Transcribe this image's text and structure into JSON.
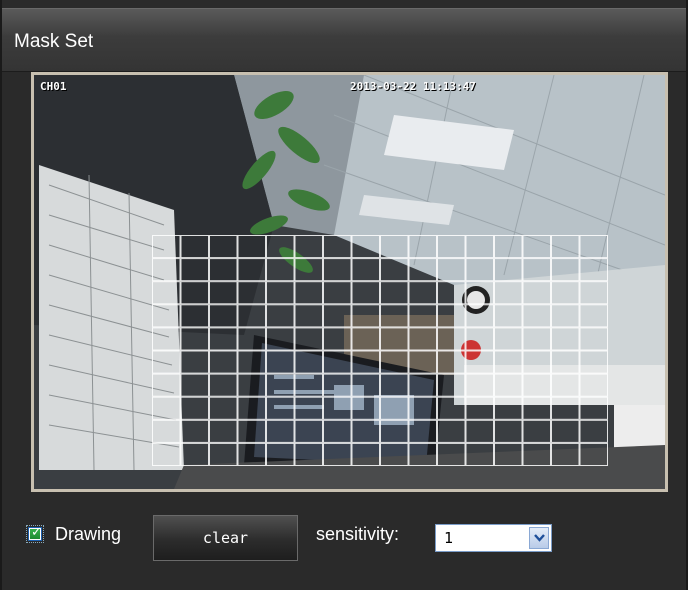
{
  "window": {
    "title": "Mask Set"
  },
  "video": {
    "channel": "CH01",
    "timestamp": "2013-03-22 11:13:47"
  },
  "mask_grid": {
    "rows": 10,
    "cols": 16
  },
  "controls": {
    "drawing_label": "Drawing",
    "drawing_checked": true,
    "clear_label": "clear",
    "sensitivity_label": "sensitivity:",
    "sensitivity_value": "1"
  },
  "colors": {
    "panel_bg": "#2a2a2a",
    "grid_line": "#ffffff",
    "checkbox_green": "#2a9c3c",
    "select_border": "#7a9cc8"
  },
  "icons": {
    "checkbox": "check-icon",
    "dropdown": "chevron-down-icon"
  }
}
